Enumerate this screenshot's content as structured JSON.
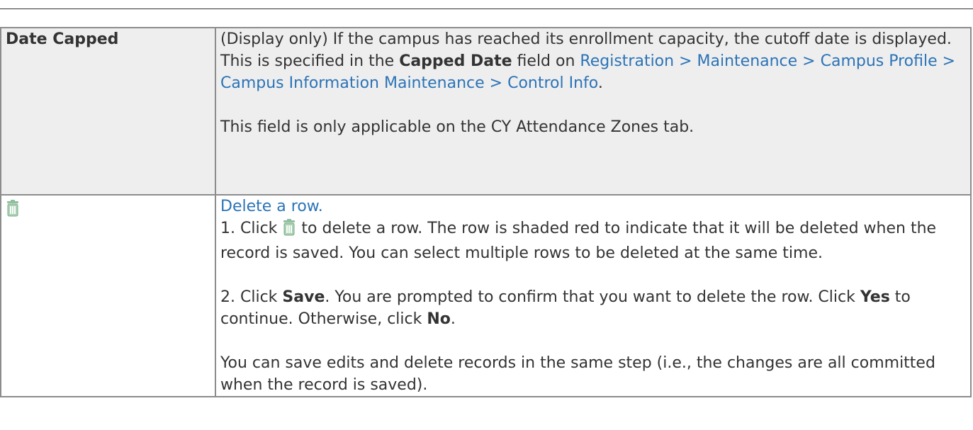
{
  "rows": [
    {
      "term": "Date Capped",
      "p1_a": "(Display only) If the campus has reached its enrollment capacity, the cutoff date is displayed. This is specified in the ",
      "p1_bold": "Capped Date",
      "p1_b": " field on ",
      "p1_link": "Registration > Maintenance > Campus Profile > Campus Information Maintenance > Control Info",
      "p1_end": ".",
      "p2": "This field is only applicable on the CY Attendance Zones tab."
    },
    {
      "term_icon": "trash-icon",
      "link": "Delete a row.",
      "s1_a": "1. Click ",
      "s1_b": " to delete a row. The row is shaded red to indicate that it will be deleted when the record is saved. You can select multiple rows to be deleted at the same time.",
      "s2_a": "2. Click ",
      "s2_save": "Save",
      "s2_b": ". You are prompted to confirm that you want to delete the row. Click ",
      "s2_yes": "Yes",
      "s2_c": " to continue. Otherwise, click ",
      "s2_no": "No",
      "s2_end": ".",
      "s3": "You can save edits and delete records in the same step (i.e., the changes are all committed when the record is saved)."
    }
  ],
  "colors": {
    "link": "#2b73b7",
    "shaded_row": "#eeeeee",
    "border": "#8c8c8c",
    "icon": "#8fbf9e"
  }
}
